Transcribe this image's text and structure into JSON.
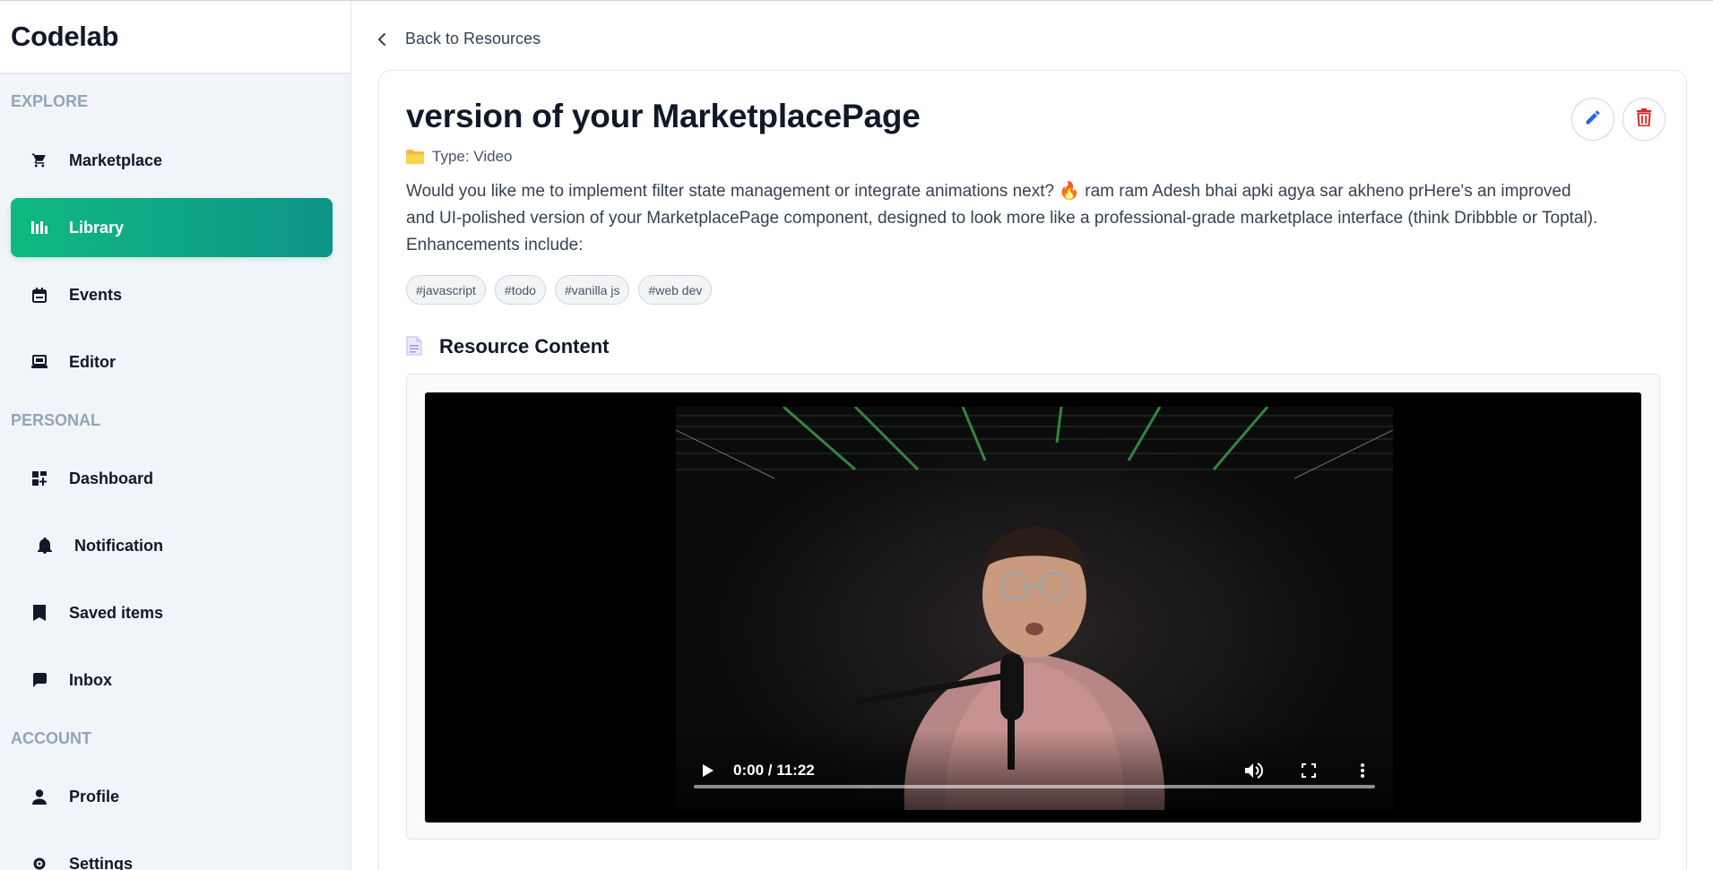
{
  "app": {
    "brand": "Codelab"
  },
  "sidebar": {
    "sections": [
      {
        "label": "EXPLORE"
      },
      {
        "label": "PERSONAL"
      },
      {
        "label": "ACCOUNT"
      }
    ],
    "items": [
      {
        "label": "Marketplace",
        "icon": "cart-icon",
        "active": false
      },
      {
        "label": "Library",
        "icon": "library-icon",
        "active": true
      },
      {
        "label": "Events",
        "icon": "calendar-icon",
        "active": false
      },
      {
        "label": "Editor",
        "icon": "laptop-icon",
        "active": false
      },
      {
        "label": "Dashboard",
        "icon": "dashboard-icon",
        "active": false
      },
      {
        "label": "Notification",
        "icon": "bell-icon",
        "active": false
      },
      {
        "label": "Saved items",
        "icon": "bookmark-icon",
        "active": false
      },
      {
        "label": "Inbox",
        "icon": "chat-icon",
        "active": false
      },
      {
        "label": "Profile",
        "icon": "user-icon",
        "active": false
      },
      {
        "label": "Settings",
        "icon": "gear-icon",
        "active": false
      }
    ]
  },
  "main": {
    "back_label": "Back to Resources",
    "title": "version of your MarketplacePage",
    "type_label": "Type: Video",
    "description": "Would you like me to implement filter state management or integrate animations next? 🔥 ram ram Adesh bhai apki agya sar akheno prHere's an improved and UI-polished version of your MarketplacePage component, designed to look more like a professional-grade marketplace interface (think Dribbble or Toptal). Enhancements include:",
    "tags": [
      "#javascript",
      "#todo",
      "#vanilla js",
      "#web dev"
    ],
    "section_title": "Resource Content",
    "video": {
      "time": "0:00 / 11:22",
      "progress": 0
    }
  },
  "colors": {
    "accent_start": "#10b981",
    "accent_end": "#0d9488",
    "edit": "#2563eb",
    "delete": "#dc2626"
  }
}
